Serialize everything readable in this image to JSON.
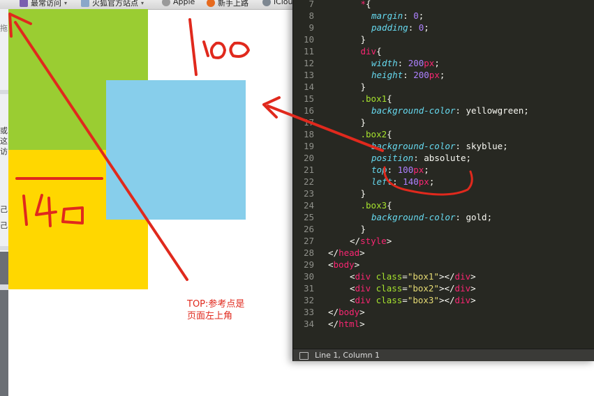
{
  "bookmarks_bar": {
    "items": [
      {
        "label": "最常访问",
        "icon": "bookmarks-folder-icon",
        "has_menu": true
      },
      {
        "label": "火狐官方站点",
        "icon": "bookmarks-folder-icon",
        "has_menu": true
      },
      {
        "label": "Apple",
        "icon": "apple-icon",
        "has_menu": false
      },
      {
        "label": "新手上路",
        "icon": "firefox-icon",
        "has_menu": false
      },
      {
        "label": "iClou",
        "icon": "globe-icon",
        "has_menu": false
      }
    ]
  },
  "side_fragments": [
    "拖",
    "或",
    "这",
    "访",
    "己.",
    "己."
  ],
  "page_boxes": [
    {
      "class": "box1",
      "color": "#9acd32"
    },
    {
      "class": "box2",
      "color": "#87ceeb"
    },
    {
      "class": "box3",
      "color": "#ffd700"
    }
  ],
  "annotations": {
    "handwritten_top": "100",
    "handwritten_left": "140",
    "note_line1": "TOP:参考点是",
    "note_line2": "页面左上角",
    "color": "#e0291d"
  },
  "editor": {
    "lines": [
      {
        "n": "7",
        "code": [
          [
            "t",
            "*"
          ],
          [
            "w",
            "{"
          ]
        ],
        "indent": 3
      },
      {
        "n": "8",
        "code": [
          [
            "p",
            "margin"
          ],
          [
            "w",
            ": "
          ],
          [
            "n",
            "0"
          ],
          [
            "w",
            ";"
          ]
        ],
        "indent": 4
      },
      {
        "n": "9",
        "code": [
          [
            "p",
            "padding"
          ],
          [
            "w",
            ": "
          ],
          [
            "n",
            "0"
          ],
          [
            "w",
            ";"
          ]
        ],
        "indent": 4
      },
      {
        "n": "10",
        "code": [
          [
            "w",
            "}"
          ]
        ],
        "indent": 3
      },
      {
        "n": "11",
        "code": [
          [
            "t",
            "div"
          ],
          [
            "w",
            "{"
          ]
        ],
        "indent": 3
      },
      {
        "n": "12",
        "code": [
          [
            "p",
            "width"
          ],
          [
            "w",
            ": "
          ],
          [
            "n",
            "200"
          ],
          [
            "u",
            "px"
          ],
          [
            "w",
            ";"
          ]
        ],
        "indent": 4
      },
      {
        "n": "13",
        "code": [
          [
            "p",
            "height"
          ],
          [
            "w",
            ": "
          ],
          [
            "n",
            "200"
          ],
          [
            "u",
            "px"
          ],
          [
            "w",
            ";"
          ]
        ],
        "indent": 4
      },
      {
        "n": "14",
        "code": [
          [
            "w",
            "}"
          ]
        ],
        "indent": 3
      },
      {
        "n": "15",
        "code": [
          [
            "s",
            ".box1"
          ],
          [
            "w",
            "{"
          ]
        ],
        "indent": 3
      },
      {
        "n": "16",
        "code": [
          [
            "p",
            "background-color"
          ],
          [
            "w",
            ": yellowgreen;"
          ]
        ],
        "indent": 4
      },
      {
        "n": "17",
        "code": [
          [
            "w",
            "}"
          ]
        ],
        "indent": 3
      },
      {
        "n": "18",
        "code": [
          [
            "s",
            ".box2"
          ],
          [
            "w",
            "{"
          ]
        ],
        "indent": 3
      },
      {
        "n": "19",
        "code": [
          [
            "p",
            "background-color"
          ],
          [
            "w",
            ": skyblue;"
          ]
        ],
        "indent": 4
      },
      {
        "n": "20",
        "code": [
          [
            "p",
            "position"
          ],
          [
            "w",
            ": absolute;"
          ]
        ],
        "indent": 4
      },
      {
        "n": "21",
        "code": [
          [
            "p",
            "top"
          ],
          [
            "w",
            ": "
          ],
          [
            "n",
            "100"
          ],
          [
            "u",
            "px"
          ],
          [
            "w",
            ";"
          ]
        ],
        "indent": 4
      },
      {
        "n": "22",
        "code": [
          [
            "p",
            "left"
          ],
          [
            "w",
            ": "
          ],
          [
            "n",
            "140"
          ],
          [
            "u",
            "px"
          ],
          [
            "w",
            ";"
          ]
        ],
        "indent": 4
      },
      {
        "n": "23",
        "code": [
          [
            "w",
            "}"
          ]
        ],
        "indent": 3
      },
      {
        "n": "24",
        "code": [
          [
            "s",
            ".box3"
          ],
          [
            "w",
            "{"
          ]
        ],
        "indent": 3
      },
      {
        "n": "25",
        "code": [
          [
            "p",
            "background-color"
          ],
          [
            "w",
            ": gold;"
          ]
        ],
        "indent": 4
      },
      {
        "n": "26",
        "code": [
          [
            "w",
            "}"
          ]
        ],
        "indent": 3
      },
      {
        "n": "27",
        "code": [
          [
            "w",
            "</"
          ],
          [
            "t",
            "style"
          ],
          [
            "w",
            ">"
          ]
        ],
        "indent": 2
      },
      {
        "n": "28",
        "code": [
          [
            "w",
            "</"
          ],
          [
            "t",
            "head"
          ],
          [
            "w",
            ">"
          ]
        ],
        "indent": 0
      },
      {
        "n": "29",
        "code": [
          [
            "w",
            "<"
          ],
          [
            "t",
            "body"
          ],
          [
            "w",
            ">"
          ]
        ],
        "indent": 0
      },
      {
        "n": "30",
        "code": [
          [
            "w",
            "<"
          ],
          [
            "t",
            "div"
          ],
          [
            "w",
            " "
          ],
          [
            "a",
            "class"
          ],
          [
            "w",
            "="
          ],
          [
            "q",
            "\"box1\""
          ],
          [
            "w",
            "></"
          ],
          [
            "t",
            "div"
          ],
          [
            "w",
            ">"
          ]
        ],
        "indent": 2
      },
      {
        "n": "31",
        "code": [
          [
            "w",
            "<"
          ],
          [
            "t",
            "div"
          ],
          [
            "w",
            " "
          ],
          [
            "a",
            "class"
          ],
          [
            "w",
            "="
          ],
          [
            "q",
            "\"box2\""
          ],
          [
            "w",
            "></"
          ],
          [
            "t",
            "div"
          ],
          [
            "w",
            ">"
          ]
        ],
        "indent": 2
      },
      {
        "n": "32",
        "code": [
          [
            "w",
            "<"
          ],
          [
            "t",
            "div"
          ],
          [
            "w",
            " "
          ],
          [
            "a",
            "class"
          ],
          [
            "w",
            "="
          ],
          [
            "q",
            "\"box3\""
          ],
          [
            "w",
            "></"
          ],
          [
            "t",
            "div"
          ],
          [
            "w",
            ">"
          ]
        ],
        "indent": 2
      },
      {
        "n": "33",
        "code": [
          [
            "w",
            "</"
          ],
          [
            "t",
            "body"
          ],
          [
            "w",
            ">"
          ]
        ],
        "indent": 0
      },
      {
        "n": "34",
        "code": [
          [
            "w",
            "</"
          ],
          [
            "t",
            "html"
          ],
          [
            "w",
            ">"
          ]
        ],
        "indent": 0
      }
    ],
    "status": "Line 1, Column 1"
  }
}
